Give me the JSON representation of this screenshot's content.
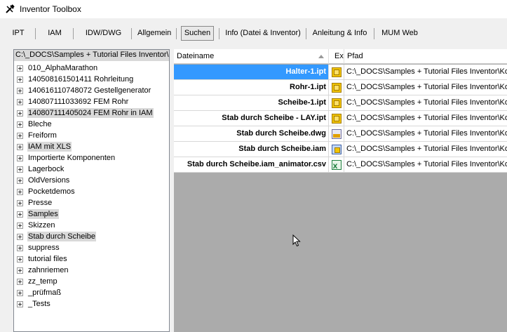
{
  "window": {
    "title": "Inventor Toolbox"
  },
  "tabs": [
    {
      "label": "IPT",
      "active": false
    },
    {
      "label": "IAM",
      "active": false
    },
    {
      "label": "IDW/DWG",
      "active": false
    },
    {
      "label": "Allgemein",
      "active": false
    },
    {
      "label": "Suchen",
      "active": true
    },
    {
      "label": "Info (Datei & Inventor)",
      "active": false
    },
    {
      "label": "Anleitung & Info",
      "active": false
    },
    {
      "label": "MUM Web",
      "active": false
    }
  ],
  "tree": {
    "root_path": "C:\\_DOCS\\Samples + Tutorial Files Inventor\\Kc",
    "items": [
      {
        "label": "010_AlphaMarathon",
        "highlighted": false
      },
      {
        "label": "140508161501411 Rohrleitung",
        "highlighted": false
      },
      {
        "label": "140616110748072 Gestellgenerator",
        "highlighted": false
      },
      {
        "label": "140807111033692 FEM Rohr",
        "highlighted": false
      },
      {
        "label": "140807111405024 FEM Rohr in IAM",
        "highlighted": true
      },
      {
        "label": "Bleche",
        "highlighted": false
      },
      {
        "label": "Freiform",
        "highlighted": false
      },
      {
        "label": "IAM mit XLS",
        "highlighted": true
      },
      {
        "label": "Importierte Komponenten",
        "highlighted": false
      },
      {
        "label": "Lagerbock",
        "highlighted": false
      },
      {
        "label": "OldVersions",
        "highlighted": false
      },
      {
        "label": "Pocketdemos",
        "highlighted": false
      },
      {
        "label": "Presse",
        "highlighted": false
      },
      {
        "label": "Samples",
        "highlighted": true
      },
      {
        "label": "Skizzen",
        "highlighted": false
      },
      {
        "label": "Stab durch Scheibe",
        "highlighted": true
      },
      {
        "label": "suppress",
        "highlighted": false
      },
      {
        "label": "tutorial files",
        "highlighted": false
      },
      {
        "label": "zahnriemen",
        "highlighted": false
      },
      {
        "label": "zz_temp",
        "highlighted": false
      },
      {
        "label": "_prüfmaß",
        "highlighted": false
      },
      {
        "label": "_Tests",
        "highlighted": false
      }
    ]
  },
  "grid": {
    "columns": [
      "Dateiname",
      "Ex",
      "Pfad"
    ],
    "rows": [
      {
        "name": "Halter-1.ipt",
        "icon": "ipt-file-icon",
        "path": "C:\\_DOCS\\Samples + Tutorial Files Inventor\\Kor",
        "selected": true
      },
      {
        "name": "Rohr-1.ipt",
        "icon": "ipt-file-icon",
        "path": "C:\\_DOCS\\Samples + Tutorial Files Inventor\\Kor",
        "selected": false
      },
      {
        "name": "Scheibe-1.ipt",
        "icon": "ipt-file-icon",
        "path": "C:\\_DOCS\\Samples + Tutorial Files Inventor\\Kor",
        "selected": false
      },
      {
        "name": "Stab durch Scheibe - LAY.ipt",
        "icon": "ipt-file-icon",
        "path": "C:\\_DOCS\\Samples + Tutorial Files Inventor\\Kor",
        "selected": false
      },
      {
        "name": "Stab durch Scheibe.dwg",
        "icon": "dwg-file-icon",
        "path": "C:\\_DOCS\\Samples + Tutorial Files Inventor\\Kor",
        "selected": false
      },
      {
        "name": "Stab durch Scheibe.iam",
        "icon": "iam-file-icon",
        "path": "C:\\_DOCS\\Samples + Tutorial Files Inventor\\Kor",
        "selected": false
      },
      {
        "name": "Stab durch Scheibe.iam_animator.csv",
        "icon": "csv-file-icon",
        "path": "C:\\_DOCS\\Samples + Tutorial Files Inventor\\Kor",
        "selected": false
      }
    ]
  },
  "colors": {
    "selection": "#3399ff",
    "grid_background": "#ababab",
    "tree_highlight": "#d9d9d9"
  }
}
